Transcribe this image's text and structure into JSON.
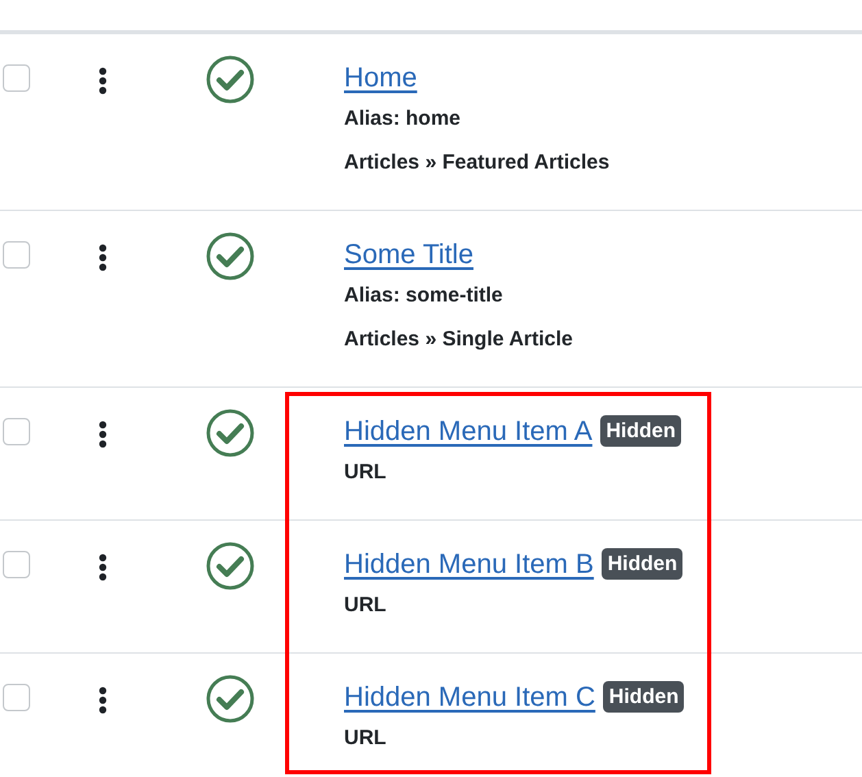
{
  "rows": [
    {
      "checked": false,
      "published": true,
      "title": "Home",
      "lines": [
        "Alias: home",
        "Articles » Featured Articles"
      ],
      "highlighted": false
    },
    {
      "checked": false,
      "published": true,
      "title": "Some Title",
      "lines": [
        "Alias: some-title",
        "Articles » Single Article"
      ],
      "highlighted": false
    },
    {
      "checked": false,
      "published": true,
      "title": "Hidden Menu Item A",
      "badge": "Hidden",
      "lines": [
        "URL"
      ],
      "highlighted": true
    },
    {
      "checked": false,
      "published": true,
      "title": "Hidden Menu Item B",
      "badge": "Hidden",
      "lines": [
        "URL"
      ],
      "highlighted": true
    },
    {
      "checked": false,
      "published": true,
      "title": "Hidden Menu Item C",
      "badge": "Hidden",
      "lines": [
        "URL"
      ],
      "highlighted": true
    }
  ]
}
